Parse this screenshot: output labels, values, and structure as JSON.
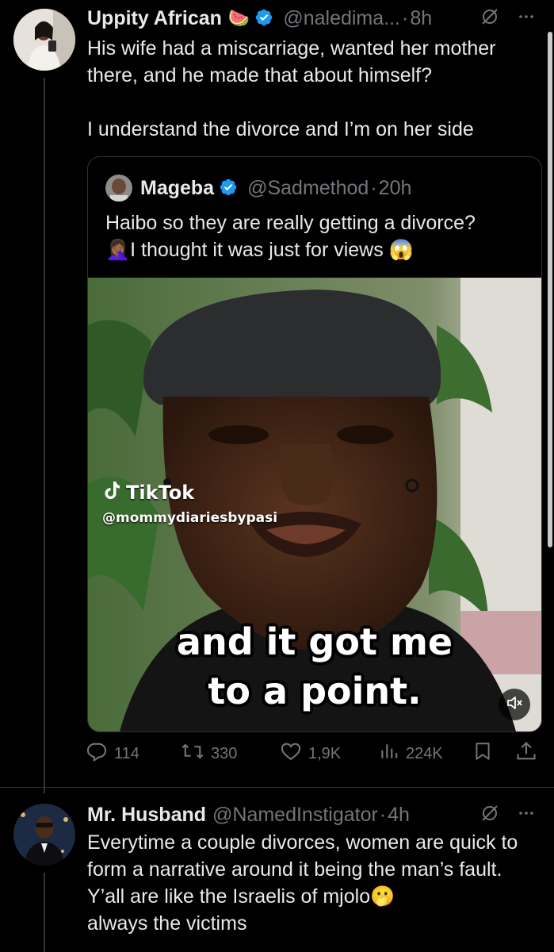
{
  "tweet1": {
    "display_name": "Uppity African",
    "name_emoji": "🍉",
    "handle": "@naledima...",
    "separator": "·",
    "time": "8h",
    "text_line1": "His wife had a miscarriage, wanted her mother there, and he made that about himself?",
    "text_line2": "I understand the divorce and I’m on her side",
    "quote": {
      "display_name": "Mageba",
      "handle": "@Sadmethod",
      "separator": "·",
      "time": "20h",
      "text_line1": "Haibo so they are really getting a divorce?",
      "text_line2_emoji": "🤦🏾‍♀️",
      "text_line2": "I thought it was just for views",
      "text_line2_end_emoji": "😱",
      "video": {
        "watermark_brand": "TikTok",
        "watermark_handle": "@mommydiariesbypasi",
        "caption_line1": "and it got me",
        "caption_line2": "to a point."
      }
    },
    "actions": {
      "replies": "114",
      "reposts": "330",
      "likes": "1,9K",
      "views": "224K"
    }
  },
  "tweet2": {
    "display_name": "Mr. Husband",
    "handle": "@NamedInstigator",
    "separator": "·",
    "time": "4h",
    "text": "Everytime a couple divorces, women are quick to form a narrative around it being the man’s fault. Y’all are like the Israelis of mjolo",
    "text_emoji": "🫢",
    "text_end": "always the victims"
  },
  "colors": {
    "background": "#000000",
    "text_primary": "#e7e9ea",
    "text_muted": "#71767b",
    "verified_blue": "#1d9bf0",
    "border": "#2f3336"
  },
  "icons": [
    "verified-icon",
    "grok-icon",
    "more-icon",
    "reply-icon",
    "repost-icon",
    "like-icon",
    "views-icon",
    "bookmark-icon",
    "share-icon",
    "mute-icon",
    "tiktok-icon"
  ]
}
